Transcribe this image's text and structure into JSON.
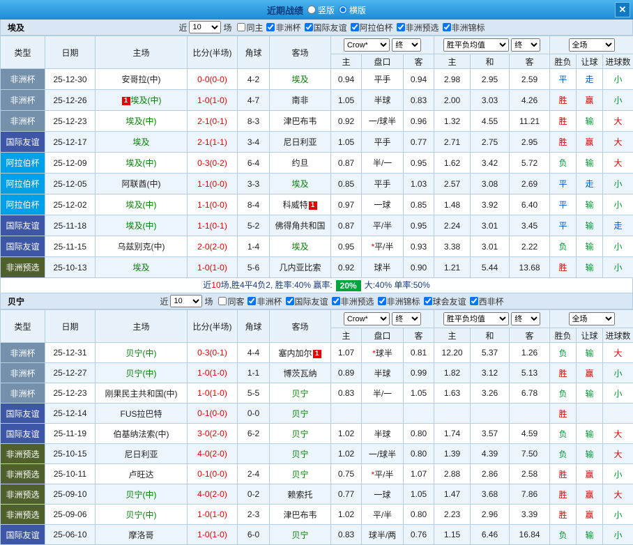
{
  "titlebar": {
    "title": "近期战绩",
    "layout_options": [
      {
        "label": "竖版",
        "selected": false
      },
      {
        "label": "横版",
        "selected": true
      }
    ],
    "close_icon": "✕"
  },
  "type_colors": {
    "非洲杯": "#7590ab",
    "国际友谊": "#3d56a6",
    "阿拉伯杯": "#00a0e9",
    "非洲预选": "#50602c"
  },
  "result_colors": {
    "red": "#e60000",
    "green": "#009933",
    "blue": "#0057d9"
  },
  "columns": {
    "type": "类型",
    "date": "日期",
    "home": "主场",
    "score": "比分(半场)",
    "corner": "角球",
    "away": "客场",
    "odds_home": "主",
    "odds_handicap": "盘口",
    "odds_away": "客",
    "euro_home": "主",
    "euro_draw": "和",
    "euro_away": "客",
    "result_wdl": "胜负",
    "result_handicap": "让球",
    "result_goals": "进球数"
  },
  "header_selects": {
    "bookmaker": "Crow*",
    "period1": "终",
    "odds_avg": "胜平负均值",
    "period2": "终",
    "scope": "全场"
  },
  "sections": [
    {
      "team": "埃及",
      "filters": {
        "near_label": "近",
        "count": "10",
        "games_label": "场",
        "checkboxes": [
          {
            "label": "同主",
            "checked": false
          },
          {
            "label": "非洲杯",
            "checked": true
          },
          {
            "label": "国际友谊",
            "checked": true
          },
          {
            "label": "阿拉伯杯",
            "checked": true
          },
          {
            "label": "非洲预选",
            "checked": true
          },
          {
            "label": "非洲锦标",
            "checked": true
          }
        ]
      },
      "rows": [
        {
          "type": "非洲杯",
          "date": "25-12-30",
          "home": {
            "text": "安哥拉(中)"
          },
          "score": "0-0(0-0)",
          "corner": "4-2",
          "away": {
            "text": "埃及",
            "green": true
          },
          "odds": [
            "0.94",
            "平手",
            "0.94"
          ],
          "euro": [
            "2.98",
            "2.95",
            "2.59"
          ],
          "results": [
            [
              "平",
              "blue"
            ],
            [
              "走",
              "blue"
            ],
            [
              "小",
              "green"
            ]
          ]
        },
        {
          "type": "非洲杯",
          "date": "25-12-26",
          "home": {
            "text": "埃及(中)",
            "green": true,
            "badge_before": "1"
          },
          "score": "1-0(1-0)",
          "corner": "4-7",
          "away": {
            "text": "南非"
          },
          "odds": [
            "1.05",
            "半球",
            "0.83"
          ],
          "euro": [
            "2.00",
            "3.03",
            "4.26"
          ],
          "results": [
            [
              "胜",
              "red"
            ],
            [
              "赢",
              "red"
            ],
            [
              "小",
              "green"
            ]
          ]
        },
        {
          "type": "非洲杯",
          "date": "25-12-23",
          "home": {
            "text": "埃及(中)",
            "green": true
          },
          "score": "2-1(0-1)",
          "corner": "8-3",
          "away": {
            "text": "津巴布韦"
          },
          "odds": [
            "0.92",
            "一/球半",
            "0.96"
          ],
          "euro": [
            "1.32",
            "4.55",
            "11.21"
          ],
          "results": [
            [
              "胜",
              "red"
            ],
            [
              "输",
              "green"
            ],
            [
              "大",
              "red"
            ]
          ]
        },
        {
          "type": "国际友谊",
          "date": "25-12-17",
          "home": {
            "text": "埃及",
            "green": true
          },
          "score": "2-1(1-1)",
          "corner": "3-4",
          "away": {
            "text": "尼日利亚"
          },
          "odds": [
            "1.05",
            "平手",
            "0.77"
          ],
          "euro": [
            "2.71",
            "2.75",
            "2.95"
          ],
          "results": [
            [
              "胜",
              "red"
            ],
            [
              "赢",
              "red"
            ],
            [
              "大",
              "red"
            ]
          ]
        },
        {
          "type": "阿拉伯杯",
          "date": "25-12-09",
          "home": {
            "text": "埃及(中)",
            "green": true
          },
          "score": "0-3(0-2)",
          "corner": "6-4",
          "away": {
            "text": "约旦"
          },
          "odds": [
            "0.87",
            "半/一",
            "0.95"
          ],
          "euro": [
            "1.62",
            "3.42",
            "5.72"
          ],
          "results": [
            [
              "负",
              "green"
            ],
            [
              "输",
              "green"
            ],
            [
              "大",
              "red"
            ]
          ]
        },
        {
          "type": "阿拉伯杯",
          "date": "25-12-05",
          "home": {
            "text": "阿联酋(中)"
          },
          "score": "1-1(0-0)",
          "corner": "3-3",
          "away": {
            "text": "埃及",
            "green": true
          },
          "odds": [
            "0.85",
            "平手",
            "1.03"
          ],
          "euro": [
            "2.57",
            "3.08",
            "2.69"
          ],
          "results": [
            [
              "平",
              "blue"
            ],
            [
              "走",
              "blue"
            ],
            [
              "小",
              "green"
            ]
          ]
        },
        {
          "type": "阿拉伯杯",
          "date": "25-12-02",
          "home": {
            "text": "埃及(中)",
            "green": true
          },
          "score": "1-1(0-0)",
          "corner": "8-4",
          "away": {
            "text": "科威特",
            "badge_after": "1"
          },
          "odds": [
            "0.97",
            "一球",
            "0.85"
          ],
          "euro": [
            "1.48",
            "3.92",
            "6.40"
          ],
          "results": [
            [
              "平",
              "blue"
            ],
            [
              "输",
              "green"
            ],
            [
              "小",
              "green"
            ]
          ]
        },
        {
          "type": "国际友谊",
          "date": "25-11-18",
          "home": {
            "text": "埃及(中)",
            "green": true
          },
          "score": "1-1(0-1)",
          "corner": "5-2",
          "away": {
            "text": "佛得角共和国"
          },
          "odds": [
            "0.87",
            "平/半",
            "0.95"
          ],
          "euro": [
            "2.24",
            "3.01",
            "3.45"
          ],
          "results": [
            [
              "平",
              "blue"
            ],
            [
              "输",
              "green"
            ],
            [
              "走",
              "blue"
            ]
          ]
        },
        {
          "type": "国际友谊",
          "date": "25-11-15",
          "home": {
            "text": "乌兹别克(中)"
          },
          "score": "2-0(2-0)",
          "corner": "1-4",
          "away": {
            "text": "埃及",
            "green": true
          },
          "odds": [
            "0.95",
            "*平/半",
            "0.93"
          ],
          "euro": [
            "3.38",
            "3.01",
            "2.22"
          ],
          "results": [
            [
              "负",
              "green"
            ],
            [
              "输",
              "green"
            ],
            [
              "小",
              "green"
            ]
          ]
        },
        {
          "type": "非洲预选",
          "date": "25-10-13",
          "home": {
            "text": "埃及",
            "green": true
          },
          "score": "1-0(1-0)",
          "corner": "5-6",
          "away": {
            "text": "几内亚比索"
          },
          "odds": [
            "0.92",
            "球半",
            "0.90"
          ],
          "euro": [
            "1.21",
            "5.44",
            "13.68"
          ],
          "results": [
            [
              "胜",
              "red"
            ],
            [
              "输",
              "green"
            ],
            [
              "小",
              "green"
            ]
          ]
        }
      ],
      "summary": {
        "segments": [
          {
            "text": "近"
          },
          {
            "text": "10",
            "color": "red"
          },
          {
            "text": "场,胜4平4负2, 胜率:40% 赢率:"
          },
          {
            "text": "20%",
            "badge": true
          },
          {
            "text": "大:40% 单率:50%"
          }
        ]
      }
    },
    {
      "team": "贝宁",
      "filters": {
        "near_label": "近",
        "count": "10",
        "games_label": "场",
        "checkboxes": [
          {
            "label": "同客",
            "checked": false
          },
          {
            "label": "非洲杯",
            "checked": true
          },
          {
            "label": "国际友谊",
            "checked": true
          },
          {
            "label": "非洲预选",
            "checked": true
          },
          {
            "label": "非洲锦标",
            "checked": true
          },
          {
            "label": "球会友谊",
            "checked": true
          },
          {
            "label": "西非杯",
            "checked": true
          }
        ]
      },
      "rows": [
        {
          "type": "非洲杯",
          "date": "25-12-31",
          "home": {
            "text": "贝宁(中)",
            "green": true
          },
          "score": "0-3(0-1)",
          "corner": "4-4",
          "away": {
            "text": "塞内加尔",
            "badge_after": "1"
          },
          "odds": [
            "1.07",
            "*球半",
            "0.81"
          ],
          "euro": [
            "12.20",
            "5.37",
            "1.26"
          ],
          "results": [
            [
              "负",
              "green"
            ],
            [
              "输",
              "green"
            ],
            [
              "大",
              "red"
            ]
          ]
        },
        {
          "type": "非洲杯",
          "date": "25-12-27",
          "home": {
            "text": "贝宁(中)",
            "green": true
          },
          "score": "1-0(1-0)",
          "corner": "1-1",
          "away": {
            "text": "博茨瓦纳"
          },
          "odds": [
            "0.89",
            "半球",
            "0.99"
          ],
          "euro": [
            "1.82",
            "3.12",
            "5.13"
          ],
          "results": [
            [
              "胜",
              "red"
            ],
            [
              "赢",
              "red"
            ],
            [
              "小",
              "green"
            ]
          ]
        },
        {
          "type": "非洲杯",
          "date": "25-12-23",
          "home": {
            "text": "刚果民主共和国(中)"
          },
          "score": "1-0(1-0)",
          "corner": "5-5",
          "away": {
            "text": "贝宁",
            "green": true
          },
          "odds": [
            "0.83",
            "半/一",
            "1.05"
          ],
          "euro": [
            "1.63",
            "3.26",
            "6.78"
          ],
          "results": [
            [
              "负",
              "green"
            ],
            [
              "输",
              "green"
            ],
            [
              "小",
              "green"
            ]
          ]
        },
        {
          "type": "国际友谊",
          "date": "25-12-14",
          "home": {
            "text": "FUS拉巴特"
          },
          "score": "0-1(0-0)",
          "corner": "0-0",
          "away": {
            "text": "贝宁",
            "green": true
          },
          "odds": [
            "",
            "",
            ""
          ],
          "euro": [
            "",
            "",
            ""
          ],
          "results": [
            [
              "胜",
              "red"
            ],
            [
              "",
              ""
            ],
            [
              "",
              ""
            ]
          ]
        },
        {
          "type": "国际友谊",
          "date": "25-11-19",
          "home": {
            "text": "伯基纳法索(中)"
          },
          "score": "3-0(2-0)",
          "corner": "6-2",
          "away": {
            "text": "贝宁",
            "green": true
          },
          "odds": [
            "1.02",
            "半球",
            "0.80"
          ],
          "euro": [
            "1.74",
            "3.57",
            "4.59"
          ],
          "results": [
            [
              "负",
              "green"
            ],
            [
              "输",
              "green"
            ],
            [
              "大",
              "red"
            ]
          ]
        },
        {
          "type": "非洲预选",
          "date": "25-10-15",
          "home": {
            "text": "尼日利亚"
          },
          "score": "4-0(2-0)",
          "corner": "",
          "away": {
            "text": "贝宁",
            "green": true
          },
          "odds": [
            "1.02",
            "一/球半",
            "0.80"
          ],
          "euro": [
            "1.39",
            "4.39",
            "7.50"
          ],
          "results": [
            [
              "负",
              "green"
            ],
            [
              "输",
              "green"
            ],
            [
              "大",
              "red"
            ]
          ]
        },
        {
          "type": "非洲预选",
          "date": "25-10-11",
          "home": {
            "text": "卢旺达"
          },
          "score": "0-1(0-0)",
          "corner": "2-4",
          "away": {
            "text": "贝宁",
            "green": true
          },
          "odds": [
            "0.75",
            "*平/半",
            "1.07"
          ],
          "euro": [
            "2.88",
            "2.86",
            "2.58"
          ],
          "results": [
            [
              "胜",
              "red"
            ],
            [
              "赢",
              "red"
            ],
            [
              "小",
              "green"
            ]
          ]
        },
        {
          "type": "非洲预选",
          "date": "25-09-10",
          "home": {
            "text": "贝宁(中)",
            "green": true
          },
          "score": "4-0(2-0)",
          "corner": "0-2",
          "away": {
            "text": "赖索托"
          },
          "odds": [
            "0.77",
            "一球",
            "1.05"
          ],
          "euro": [
            "1.47",
            "3.68",
            "7.86"
          ],
          "results": [
            [
              "胜",
              "red"
            ],
            [
              "赢",
              "red"
            ],
            [
              "大",
              "red"
            ]
          ]
        },
        {
          "type": "非洲预选",
          "date": "25-09-06",
          "home": {
            "text": "贝宁(中)",
            "green": true
          },
          "score": "1-0(1-0)",
          "corner": "2-3",
          "away": {
            "text": "津巴布韦"
          },
          "odds": [
            "1.02",
            "平/半",
            "0.80"
          ],
          "euro": [
            "2.23",
            "2.96",
            "3.39"
          ],
          "results": [
            [
              "胜",
              "red"
            ],
            [
              "赢",
              "red"
            ],
            [
              "小",
              "green"
            ]
          ]
        },
        {
          "type": "国际友谊",
          "date": "25-06-10",
          "home": {
            "text": "摩洛哥"
          },
          "score": "1-0(1-0)",
          "corner": "6-0",
          "away": {
            "text": "贝宁",
            "green": true
          },
          "odds": [
            "0.83",
            "球半/两",
            "0.76"
          ],
          "euro": [
            "1.15",
            "6.46",
            "16.84"
          ],
          "results": [
            [
              "负",
              "green"
            ],
            [
              "输",
              "green"
            ],
            [
              "小",
              "green"
            ]
          ]
        }
      ],
      "summary": null
    }
  ]
}
